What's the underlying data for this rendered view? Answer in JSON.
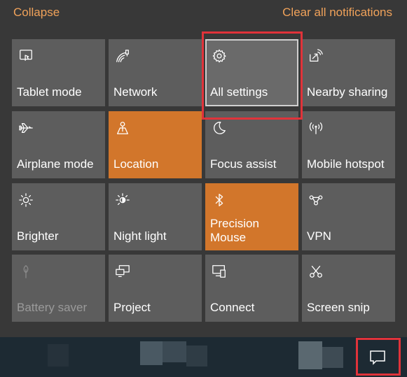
{
  "header": {
    "collapse_label": "Collapse",
    "clear_label": "Clear all notifications"
  },
  "tiles": [
    {
      "label": "Tablet mode",
      "icon": "tablet-mode-icon"
    },
    {
      "label": "Network",
      "icon": "network-icon"
    },
    {
      "label": "All settings",
      "icon": "gear-icon"
    },
    {
      "label": "Nearby sharing",
      "icon": "nearby-sharing-icon"
    },
    {
      "label": "Airplane mode",
      "icon": "airplane-icon"
    },
    {
      "label": "Location",
      "icon": "location-icon",
      "active": true
    },
    {
      "label": "Focus assist",
      "icon": "moon-icon"
    },
    {
      "label": "Mobile hotspot",
      "icon": "hotspot-icon"
    },
    {
      "label": "Brighter",
      "icon": "sun-icon"
    },
    {
      "label": "Night light",
      "icon": "night-light-icon"
    },
    {
      "label": "Precision Mouse",
      "icon": "bluetooth-icon",
      "active": true
    },
    {
      "label": "VPN",
      "icon": "vpn-icon"
    },
    {
      "label": "Battery saver",
      "icon": "battery-saver-icon",
      "disabled": true
    },
    {
      "label": "Project",
      "icon": "project-icon"
    },
    {
      "label": "Connect",
      "icon": "connect-icon"
    },
    {
      "label": "Screen snip",
      "icon": "screen-snip-icon"
    }
  ],
  "colors": {
    "accent": "#d2762b",
    "tile": "#5d5d5d",
    "link": "#f0a25a",
    "highlight": "#e0333a"
  }
}
